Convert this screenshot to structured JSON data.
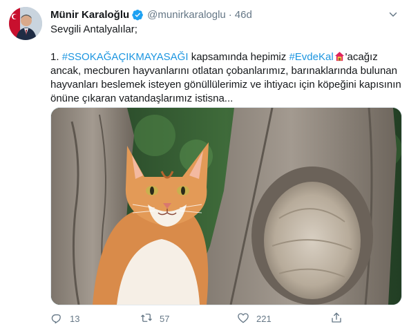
{
  "author": {
    "name": "Münir Karaloğlu",
    "handle": "@munirkaraloglu",
    "separator": "·",
    "time": "46d"
  },
  "tweet": {
    "greeting": "Sevgili Antalyalılar;",
    "line1_prefix": "1. ",
    "hashtag1": "#SSOKAĞAÇIKMAYASAĞI",
    "line1_middle": " kapsamında hepimiz ",
    "hashtag2": "#EvdeKal",
    "line1_suffix": "'acağız ancak,",
    "body_rest": "mecburen hayvanlarını otlatan çobanlarımız, barınaklarında bulunan hayvanları beslemek isteyen gönüllülerimiz ve ihtiyacı için köpeğini kapısının önüne çıkaran vatandaşlarımız istisna..."
  },
  "actions": {
    "reply_count": "13",
    "retweet_count": "57",
    "like_count": "221"
  },
  "icons": {
    "verified": "verified-badge-icon",
    "caret": "chevron-down-icon",
    "reply": "reply-icon",
    "retweet": "retweet-icon",
    "like": "heart-icon",
    "share": "share-icon",
    "house": "house-emoji-icon"
  },
  "colors": {
    "link": "#1b95e0",
    "text": "#14171a",
    "muted": "#657786",
    "verified": "#1da1f2"
  }
}
